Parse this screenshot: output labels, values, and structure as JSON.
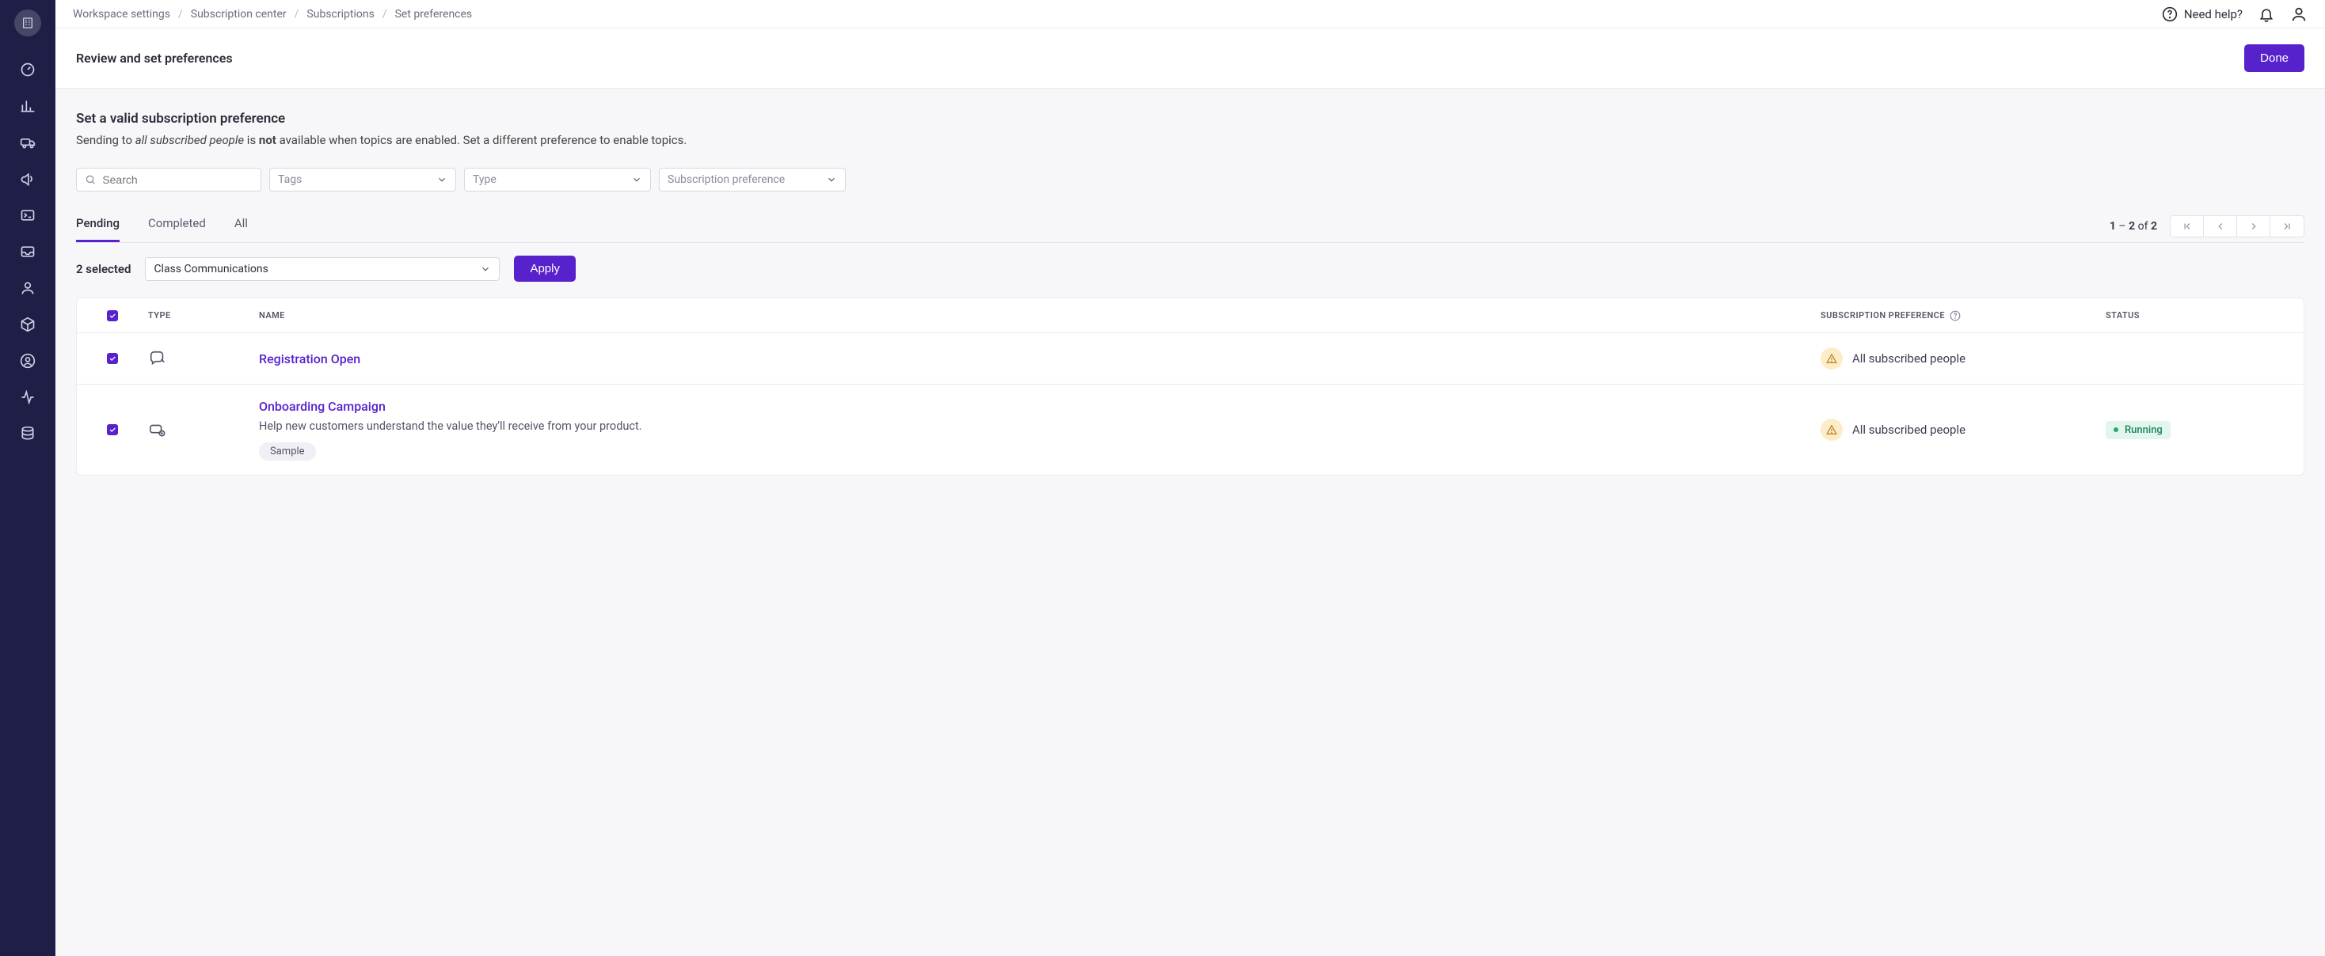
{
  "breadcrumbs": {
    "items": [
      "Workspace settings",
      "Subscription center",
      "Subscriptions"
    ],
    "current": "Set preferences"
  },
  "topbar": {
    "help_label": "Need help?"
  },
  "subheader": {
    "title": "Review and set preferences",
    "done_label": "Done"
  },
  "banner": {
    "title": "Set a valid subscription preference",
    "prefix": "Sending to ",
    "em": "all subscribed people",
    "mid": " is ",
    "strong": "not",
    "suffix": " available when topics are enabled. Set a different preference to enable topics."
  },
  "filters": {
    "search_placeholder": "Search",
    "tags_label": "Tags",
    "type_label": "Type",
    "pref_label": "Subscription preference"
  },
  "tabs": {
    "items": [
      "Pending",
      "Completed",
      "All"
    ],
    "active_index": 0
  },
  "pagination": {
    "start": "1",
    "end": "2",
    "of_label": "of",
    "total": "2"
  },
  "bulk": {
    "selected_label": "2 selected",
    "dropdown_value": "Class Communications",
    "apply_label": "Apply"
  },
  "table": {
    "headers": {
      "type": "TYPE",
      "name": "NAME",
      "pref": "SUBSCRIPTION PREFERENCE",
      "status": "STATUS"
    },
    "rows": [
      {
        "name": "Registration Open",
        "desc": "",
        "chip": "",
        "pref": "All subscribed people",
        "status": ""
      },
      {
        "name": "Onboarding Campaign",
        "desc": "Help new customers understand the value they'll receive from your product.",
        "chip": "Sample",
        "pref": "All subscribed people",
        "status": "Running"
      }
    ]
  }
}
